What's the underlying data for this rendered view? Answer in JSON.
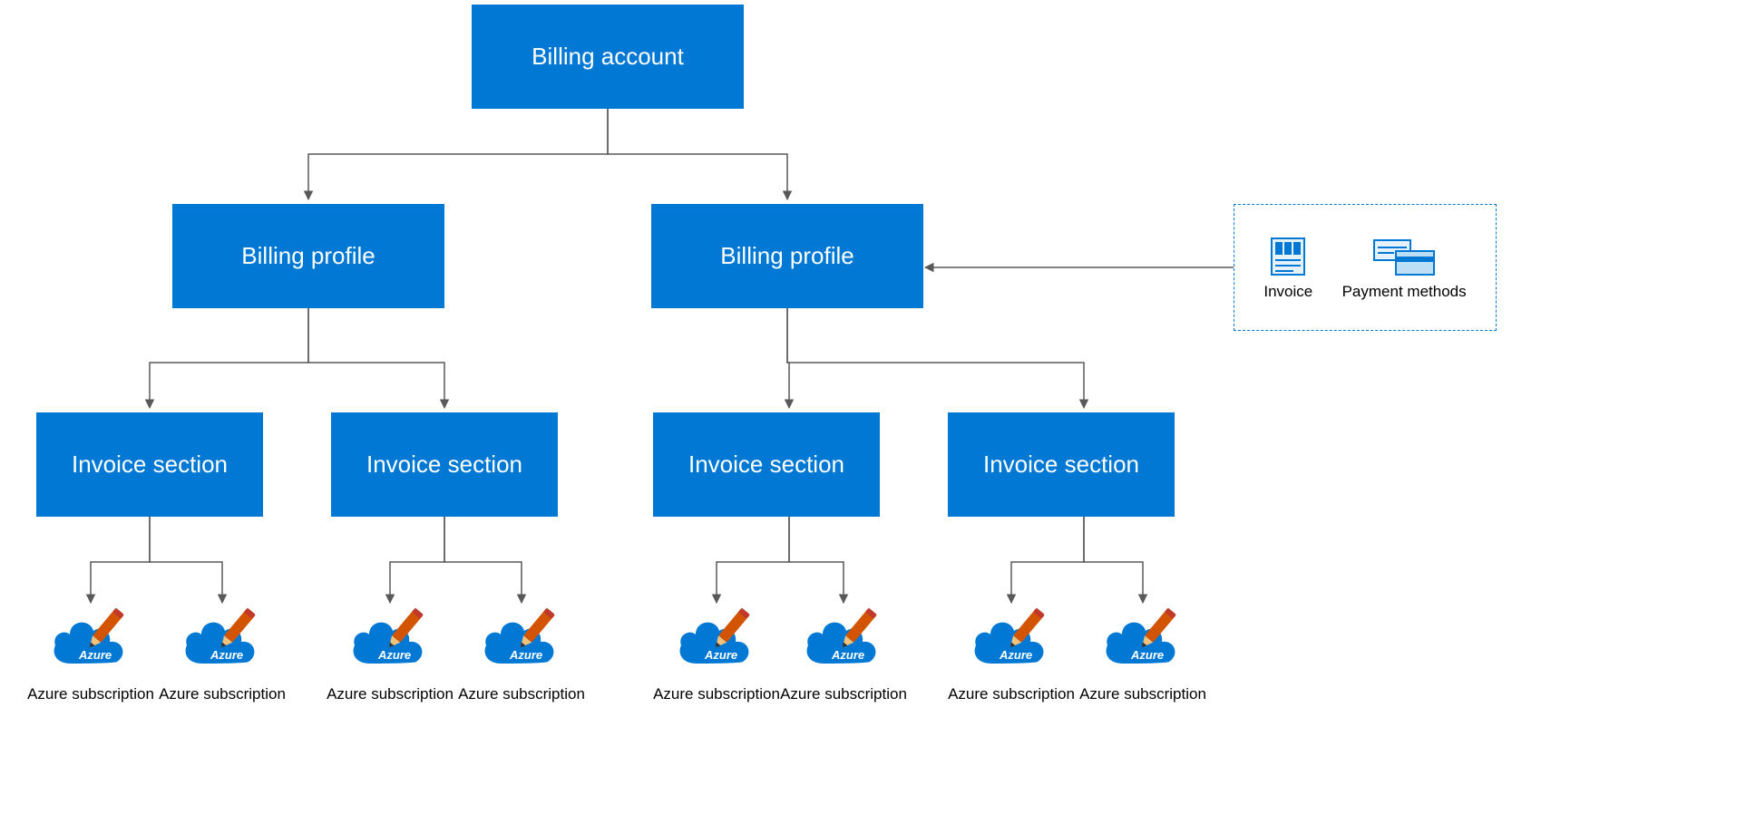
{
  "colors": {
    "primary": "#0078d4",
    "cloud": "#0078d4",
    "pencil": "#d35400",
    "pencilTip": "#c0392b"
  },
  "root": {
    "label": "Billing account"
  },
  "profiles": [
    {
      "label": "Billing profile"
    },
    {
      "label": "Billing profile"
    }
  ],
  "sections": [
    {
      "label": "Invoice section"
    },
    {
      "label": "Invoice section"
    },
    {
      "label": "Invoice section"
    },
    {
      "label": "Invoice section"
    }
  ],
  "subscription_label": "Azure subscription",
  "azure_word": "Azure",
  "info": {
    "invoice_label": "Invoice",
    "payment_label": "Payment methods"
  }
}
